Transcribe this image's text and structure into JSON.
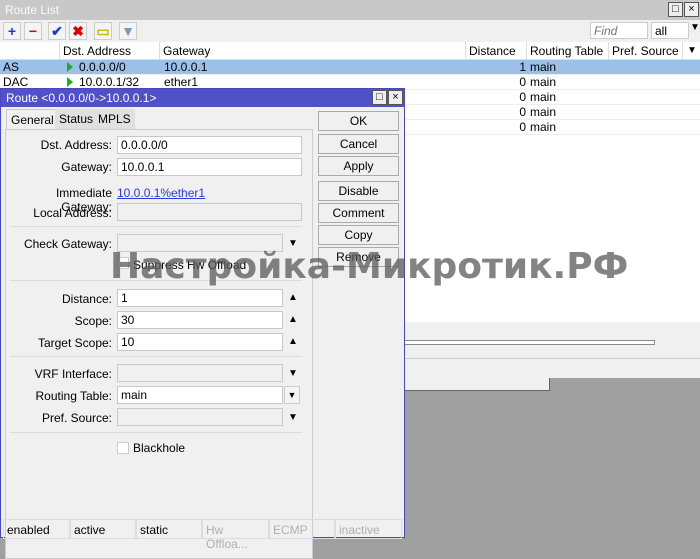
{
  "route_list": {
    "title": "Route List",
    "toolbar": {
      "add": "+",
      "remove": "−",
      "enable": "✔",
      "disable": "✖",
      "comment": "▭",
      "filter": "▼"
    },
    "find_placeholder": "Find",
    "filter_value": "all",
    "columns": [
      "",
      "Dst. Address",
      "Gateway",
      "Distance",
      "Routing Table",
      "Pref. Source"
    ],
    "rows": [
      {
        "flags": "AS",
        "dst": "0.0.0.0/0",
        "gateway": "10.0.0.1",
        "distance": "1",
        "table": "main",
        "selected": true
      },
      {
        "flags": "DAC",
        "dst": "10.0.0.1/32",
        "gateway": "ether1",
        "distance": "0",
        "table": "main"
      },
      {
        "flags": "",
        "dst": "",
        "gateway": "",
        "distance": "0",
        "table": "main"
      },
      {
        "flags": "",
        "dst": "",
        "gateway": "",
        "distance": "0",
        "table": "main"
      },
      {
        "flags": "",
        "dst": "",
        "gateway": "",
        "distance": "0",
        "table": "main"
      }
    ]
  },
  "dialog": {
    "title": "Route <0.0.0.0/0->10.0.0.1>",
    "tabs": [
      "General",
      "Status",
      "MPLS"
    ],
    "fields": {
      "dst_label": "Dst. Address:",
      "dst": "0.0.0.0/0",
      "gw_label": "Gateway:",
      "gw": "10.0.0.1",
      "imm_label": "Immediate Gateway:",
      "imm": "10.0.0.1%ether1",
      "local_label": "Local Address:",
      "check_label": "Check Gateway:",
      "suppress": "Suppress Hw Offload",
      "distance_label": "Distance:",
      "distance": "1",
      "scope_label": "Scope:",
      "scope": "30",
      "tscope_label": "Target Scope:",
      "tscope": "10",
      "vrf_label": "VRF Interface:",
      "table_label": "Routing Table:",
      "table": "main",
      "pref_label": "Pref. Source:",
      "blackhole": "Blackhole"
    },
    "buttons": [
      "OK",
      "Cancel",
      "Apply",
      "Disable",
      "Comment",
      "Copy",
      "Remove"
    ],
    "status": [
      "enabled",
      "active",
      "static",
      "Hw Offloa...",
      "ECMP",
      "inactive"
    ]
  },
  "watermark": "Настройка-Микротик.РФ"
}
